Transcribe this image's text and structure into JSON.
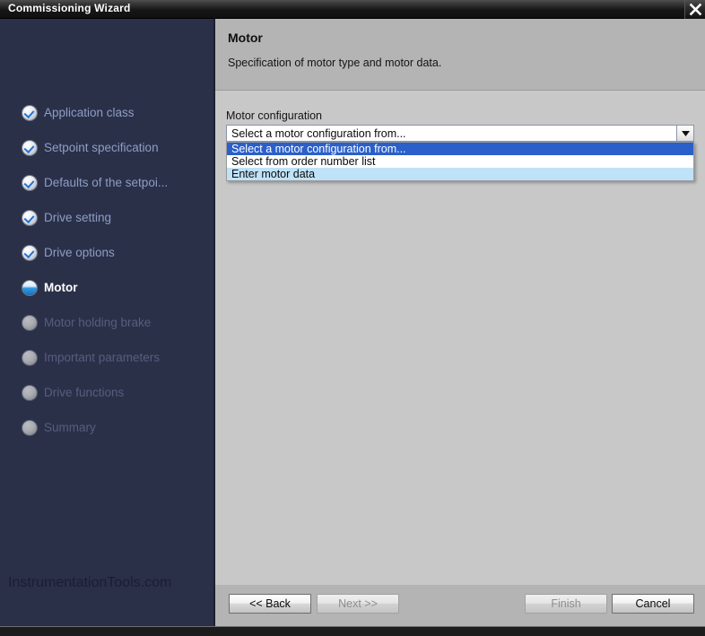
{
  "window": {
    "title": "Commissioning Wizard",
    "close_icon": "close-x-icon"
  },
  "sidebar": {
    "watermark": "InstrumentationTools.com",
    "steps": [
      {
        "label": "Application class",
        "state": "done",
        "icon": "check-circle-icon"
      },
      {
        "label": "Setpoint specification",
        "state": "done",
        "icon": "check-circle-icon"
      },
      {
        "label": "Defaults of the setpoi...",
        "state": "done",
        "icon": "check-circle-icon"
      },
      {
        "label": "Drive setting",
        "state": "done",
        "icon": "check-circle-icon"
      },
      {
        "label": "Drive options",
        "state": "done",
        "icon": "check-circle-icon"
      },
      {
        "label": "Motor",
        "state": "active",
        "icon": "active-circle-icon"
      },
      {
        "label": "Motor holding brake",
        "state": "todo",
        "icon": "empty-circle-icon"
      },
      {
        "label": "Important parameters",
        "state": "todo",
        "icon": "empty-circle-icon"
      },
      {
        "label": "Drive functions",
        "state": "todo",
        "icon": "empty-circle-icon"
      },
      {
        "label": "Summary",
        "state": "todo",
        "icon": "empty-circle-icon"
      }
    ]
  },
  "main": {
    "title": "Motor",
    "subtitle": "Specification of motor type and motor data.",
    "field_label": "Motor configuration",
    "combo": {
      "value": "Select a motor configuration from...",
      "arrow_icon": "chevron-down-icon",
      "expanded": true,
      "options": [
        {
          "label": "Select a motor configuration from...",
          "state": "selected"
        },
        {
          "label": "Select from order number list",
          "state": "normal"
        },
        {
          "label": "Enter motor data",
          "state": "hover"
        }
      ]
    }
  },
  "footer": {
    "back": "<< Back",
    "next": "Next >>",
    "finish": "Finish",
    "cancel": "Cancel"
  },
  "colors": {
    "sidebar_bg": "#2b3049",
    "content_bg": "#c8c8c8",
    "header_bg": "#b4b4b4",
    "selected_blue": "#2b5fc9",
    "hover_blue": "#bfe2f8",
    "done_label": "#8d9ec4",
    "todo_label": "#565e7d"
  }
}
